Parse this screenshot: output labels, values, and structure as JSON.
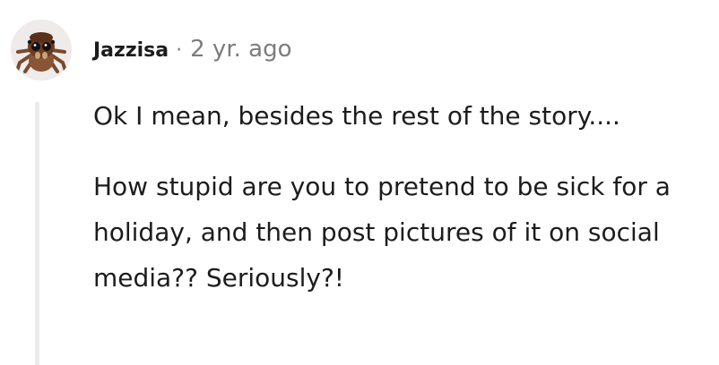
{
  "comment": {
    "avatar_icon": "jumping-spider-avatar",
    "author": "Jazzisa",
    "separator": "·",
    "timestamp": "2 yr. ago",
    "paragraphs": [
      "Ok I mean, besides the rest of the story....",
      "How stupid are you to pretend to be sick for a holiday, and then post pictures of it on social media?? Seriously?!"
    ]
  },
  "colors": {
    "text": "#1c1c1c",
    "muted": "#7c7c7c",
    "thread_line": "#ebebeb"
  }
}
